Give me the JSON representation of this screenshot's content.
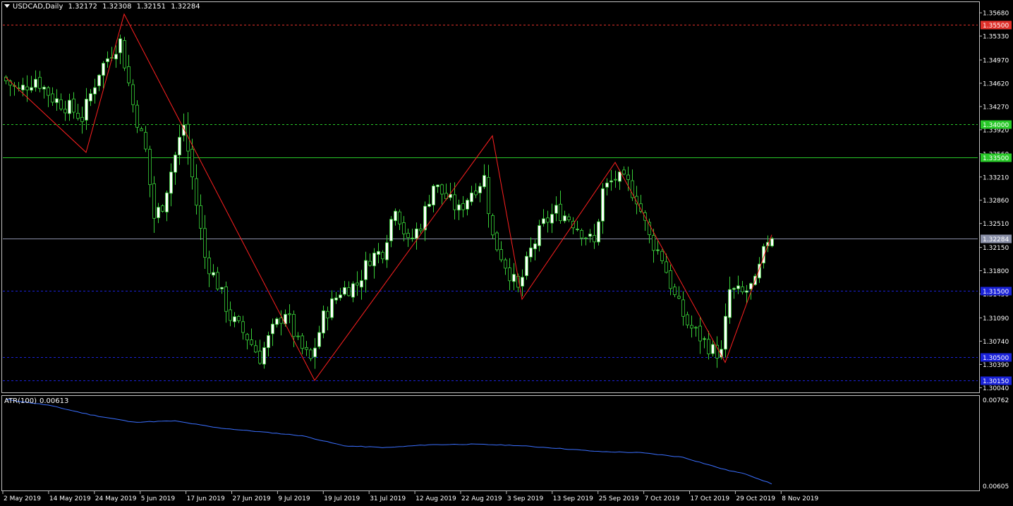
{
  "header": {
    "symbol": "USDCAD,Daily",
    "open": "1.32172",
    "high": "1.32308",
    "low": "1.32151",
    "close": "1.32284"
  },
  "indicator": {
    "name": "ATR(100)",
    "value": "0.00613",
    "axis_top": "0.00762",
    "axis_bottom": "0.00605"
  },
  "price_axis": {
    "labels": [
      "1.35680",
      "1.35330",
      "1.34970",
      "1.34620",
      "1.34270",
      "1.33920",
      "1.33560",
      "1.33210",
      "1.32860",
      "1.32510",
      "1.32150",
      "1.31800",
      "1.31450",
      "1.31090",
      "1.30740",
      "1.30390",
      "1.30040"
    ]
  },
  "levels": [
    {
      "price": 1.355,
      "label": "1.35500",
      "color": "#e0302a",
      "style": "dashed"
    },
    {
      "price": 1.34,
      "label": "1.34000",
      "color": "#28c828",
      "style": "dashed"
    },
    {
      "price": 1.335,
      "label": "1.33500",
      "color": "#28c828",
      "style": "solid"
    },
    {
      "price": 1.32284,
      "label": "1.32284",
      "color": "#8a90a8",
      "style": "solid"
    },
    {
      "price": 1.315,
      "label": "1.31500",
      "color": "#1a22d8",
      "style": "dashed"
    },
    {
      "price": 1.305,
      "label": "1.30500",
      "color": "#1a22d8",
      "style": "dashed"
    },
    {
      "price": 1.3015,
      "label": "1.30150",
      "color": "#1a22d8",
      "style": "dashed"
    }
  ],
  "time_axis": {
    "labels": [
      "2 May 2019",
      "14 May 2019",
      "24 May 2019",
      "5 Jun 2019",
      "17 Jun 2019",
      "27 Jun 2019",
      "9 Jul 2019",
      "19 Jul 2019",
      "31 Jul 2019",
      "12 Aug 2019",
      "22 Aug 2019",
      "3 Sep 2019",
      "13 Sep 2019",
      "25 Sep 2019",
      "7 Oct 2019",
      "17 Oct 2019",
      "29 Oct 2019",
      "8 Nov 2019"
    ]
  },
  "zigzag": {
    "color": "#ff2020",
    "points": [
      {
        "bar": 0,
        "price": 1.3471
      },
      {
        "bar": 19,
        "price": 1.3358
      },
      {
        "bar": 28,
        "price": 1.3566
      },
      {
        "bar": 73,
        "price": 1.3015
      },
      {
        "bar": 115,
        "price": 1.3383
      },
      {
        "bar": 122,
        "price": 1.3137
      },
      {
        "bar": 144,
        "price": 1.3343
      },
      {
        "bar": 170,
        "price": 1.3042
      },
      {
        "bar": 181,
        "price": 1.3234
      }
    ]
  },
  "chart_data": {
    "type": "candlestick",
    "title": "USDCAD,Daily",
    "candle_color_up": "#ffffff",
    "candle_color_down": "#000000",
    "wick_color": "#38d038",
    "ylim": [
      1.2998,
      1.3583
    ],
    "x": [
      "2 May 2019",
      "14 May 2019",
      "24 May 2019",
      "5 Jun 2019",
      "17 Jun 2019",
      "27 Jun 2019",
      "9 Jul 2019",
      "19 Jul 2019",
      "31 Jul 2019",
      "12 Aug 2019",
      "22 Aug 2019",
      "3 Sep 2019",
      "13 Sep 2019",
      "25 Sep 2019",
      "7 Oct 2019",
      "17 Oct 2019",
      "29 Oct 2019",
      "8 Nov 2019"
    ],
    "anchors": [
      {
        "bar": 0,
        "price": 1.3471
      },
      {
        "bar": 4,
        "price": 1.345
      },
      {
        "bar": 8,
        "price": 1.347
      },
      {
        "bar": 12,
        "price": 1.344
      },
      {
        "bar": 16,
        "price": 1.3425
      },
      {
        "bar": 19,
        "price": 1.341
      },
      {
        "bar": 23,
        "price": 1.348
      },
      {
        "bar": 26,
        "price": 1.351
      },
      {
        "bar": 28,
        "price": 1.3525
      },
      {
        "bar": 31,
        "price": 1.343
      },
      {
        "bar": 34,
        "price": 1.336
      },
      {
        "bar": 36,
        "price": 1.326
      },
      {
        "bar": 38,
        "price": 1.328
      },
      {
        "bar": 40,
        "price": 1.333
      },
      {
        "bar": 43,
        "price": 1.34
      },
      {
        "bar": 46,
        "price": 1.328
      },
      {
        "bar": 48,
        "price": 1.32
      },
      {
        "bar": 51,
        "price": 1.316
      },
      {
        "bar": 54,
        "price": 1.311
      },
      {
        "bar": 58,
        "price": 1.308
      },
      {
        "bar": 61,
        "price": 1.305
      },
      {
        "bar": 64,
        "price": 1.309
      },
      {
        "bar": 67,
        "price": 1.312
      },
      {
        "bar": 70,
        "price": 1.307
      },
      {
        "bar": 73,
        "price": 1.3045
      },
      {
        "bar": 76,
        "price": 1.311
      },
      {
        "bar": 80,
        "price": 1.315
      },
      {
        "bar": 84,
        "price": 1.316
      },
      {
        "bar": 87,
        "price": 1.32
      },
      {
        "bar": 90,
        "price": 1.321
      },
      {
        "bar": 93,
        "price": 1.328
      },
      {
        "bar": 96,
        "price": 1.322
      },
      {
        "bar": 99,
        "price": 1.325
      },
      {
        "bar": 102,
        "price": 1.331
      },
      {
        "bar": 105,
        "price": 1.329
      },
      {
        "bar": 108,
        "price": 1.327
      },
      {
        "bar": 111,
        "price": 1.33
      },
      {
        "bar": 114,
        "price": 1.332
      },
      {
        "bar": 116,
        "price": 1.323
      },
      {
        "bar": 119,
        "price": 1.319
      },
      {
        "bar": 122,
        "price": 1.315
      },
      {
        "bar": 125,
        "price": 1.321
      },
      {
        "bar": 128,
        "price": 1.325
      },
      {
        "bar": 131,
        "price": 1.327
      },
      {
        "bar": 134,
        "price": 1.326
      },
      {
        "bar": 137,
        "price": 1.324
      },
      {
        "bar": 140,
        "price": 1.322
      },
      {
        "bar": 142,
        "price": 1.33
      },
      {
        "bar": 145,
        "price": 1.332
      },
      {
        "bar": 148,
        "price": 1.331
      },
      {
        "bar": 150,
        "price": 1.329
      },
      {
        "bar": 153,
        "price": 1.323
      },
      {
        "bar": 156,
        "price": 1.32
      },
      {
        "bar": 159,
        "price": 1.314
      },
      {
        "bar": 162,
        "price": 1.31
      },
      {
        "bar": 165,
        "price": 1.308
      },
      {
        "bar": 168,
        "price": 1.306
      },
      {
        "bar": 170,
        "price": 1.3055
      },
      {
        "bar": 172,
        "price": 1.315
      },
      {
        "bar": 175,
        "price": 1.3145
      },
      {
        "bar": 178,
        "price": 1.316
      },
      {
        "bar": 181,
        "price": 1.3228
      }
    ],
    "bar_count": 182,
    "last_candle": {
      "open": 1.32172,
      "high": 1.32308,
      "low": 1.32151,
      "close": 1.32284
    },
    "atr": {
      "name": "ATR(100)",
      "ylim": [
        0.00605,
        0.00762
      ],
      "anchors": [
        {
          "bar": 0,
          "value": 0.00762
        },
        {
          "bar": 10,
          "value": 0.00752
        },
        {
          "bar": 20,
          "value": 0.00735
        },
        {
          "bar": 30,
          "value": 0.00722
        },
        {
          "bar": 40,
          "value": 0.00724
        },
        {
          "bar": 50,
          "value": 0.00712
        },
        {
          "bar": 60,
          "value": 0.00705
        },
        {
          "bar": 70,
          "value": 0.00698
        },
        {
          "bar": 80,
          "value": 0.0068
        },
        {
          "bar": 90,
          "value": 0.00677
        },
        {
          "bar": 100,
          "value": 0.00682
        },
        {
          "bar": 110,
          "value": 0.00683
        },
        {
          "bar": 120,
          "value": 0.00681
        },
        {
          "bar": 130,
          "value": 0.00676
        },
        {
          "bar": 140,
          "value": 0.0067
        },
        {
          "bar": 150,
          "value": 0.00668
        },
        {
          "bar": 160,
          "value": 0.0066
        },
        {
          "bar": 170,
          "value": 0.00638
        },
        {
          "bar": 175,
          "value": 0.0063
        },
        {
          "bar": 181,
          "value": 0.00613
        }
      ]
    }
  }
}
